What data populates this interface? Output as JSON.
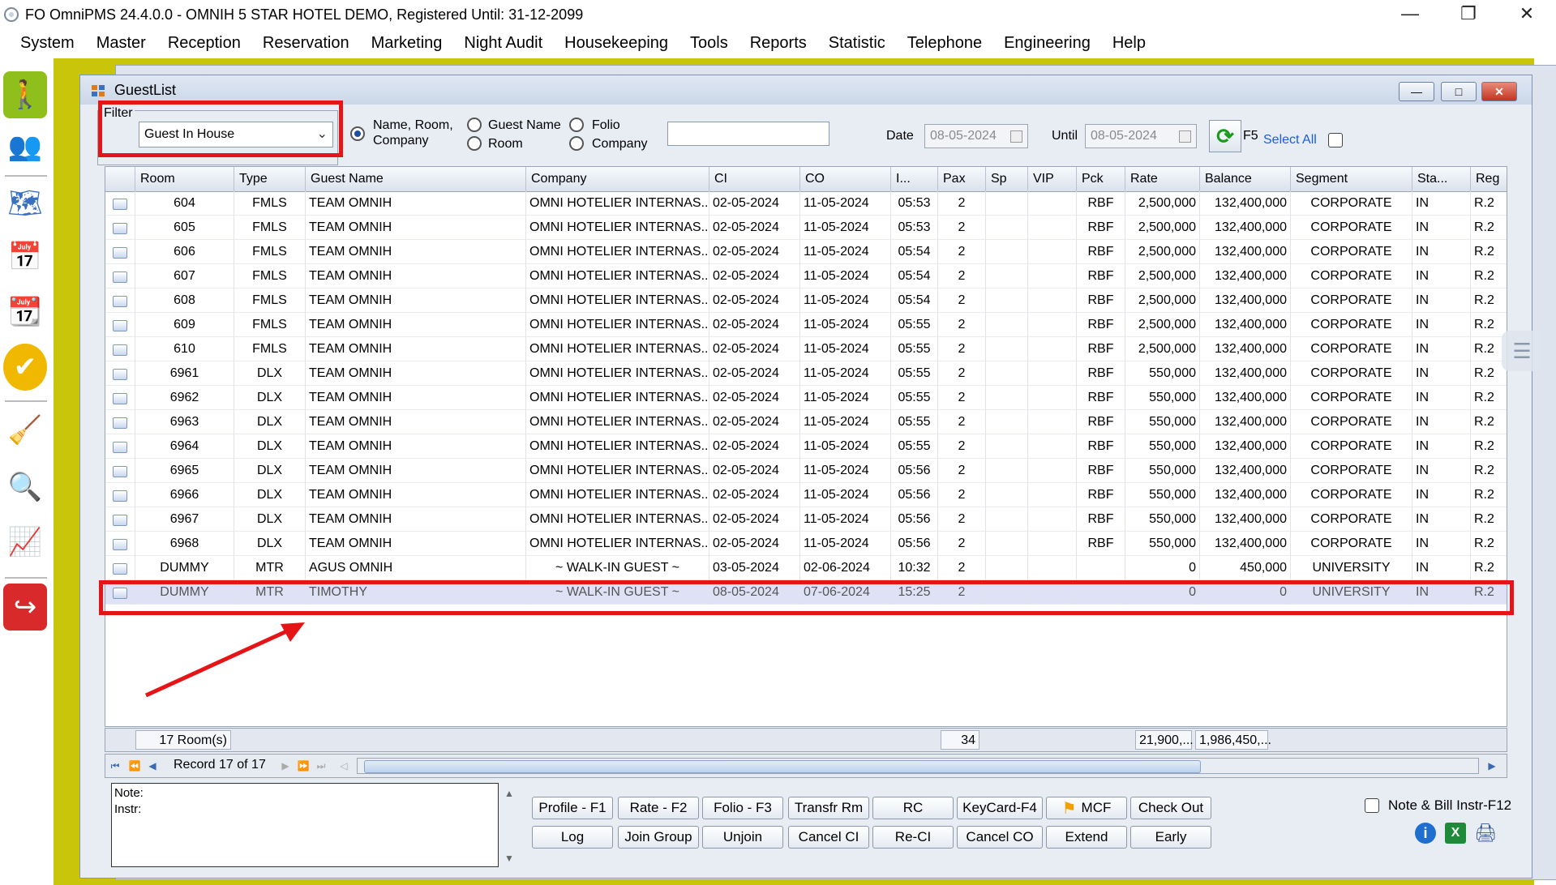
{
  "window": {
    "title": "FO OmniPMS 24.4.0.0 - OMNIH 5 STAR HOTEL DEMO, Registered Until: 31-12-2099"
  },
  "menu": [
    "System",
    "Master",
    "Reception",
    "Reservation",
    "Marketing",
    "Night Audit",
    "Housekeeping",
    "Tools",
    "Reports",
    "Statistic",
    "Telephone",
    "Engineering",
    "Help"
  ],
  "sidebar_icons": [
    "walk-in-icon",
    "guests-icon",
    "room-plan-icon",
    "calendar-icon",
    "calendar-2023-icon",
    "availability-icon",
    "housekeeping-icon",
    "analytics-icon",
    "report-chart-icon",
    "exit-icon"
  ],
  "guestlist": {
    "title": "GuestList",
    "filter_label": "Filter",
    "filter_value": "Guest In House",
    "radio_name_room_company": "Name, Room, Company",
    "radio_guest_name": "Guest Name",
    "radio_room": "Room",
    "radio_folio": "Folio",
    "radio_company": "Company",
    "date_label": "Date",
    "date_value": "08-05-2024",
    "until_label": "Until",
    "until_value": "08-05-2024",
    "f5_label": "F5",
    "select_all": "Select All"
  },
  "columns": [
    "Room",
    "Type",
    "Guest Name",
    "Company",
    "CI",
    "CO",
    "I...",
    "Pax",
    "Sp",
    "VIP",
    "Pck",
    "Rate",
    "Balance",
    "Segment",
    "Sta...",
    "Reg"
  ],
  "rows": [
    [
      "604",
      "FMLS",
      "TEAM OMNIH",
      "OMNI HOTELIER INTERNAS...",
      "02-05-2024",
      "11-05-2024",
      "05:53",
      "2",
      "",
      "",
      "RBF",
      "2,500,000",
      "132,400,000",
      "CORPORATE",
      "IN",
      "R.2"
    ],
    [
      "605",
      "FMLS",
      "TEAM OMNIH",
      "OMNI HOTELIER INTERNAS...",
      "02-05-2024",
      "11-05-2024",
      "05:53",
      "2",
      "",
      "",
      "RBF",
      "2,500,000",
      "132,400,000",
      "CORPORATE",
      "IN",
      "R.2"
    ],
    [
      "606",
      "FMLS",
      "TEAM OMNIH",
      "OMNI HOTELIER INTERNAS...",
      "02-05-2024",
      "11-05-2024",
      "05:54",
      "2",
      "",
      "",
      "RBF",
      "2,500,000",
      "132,400,000",
      "CORPORATE",
      "IN",
      "R.2"
    ],
    [
      "607",
      "FMLS",
      "TEAM OMNIH",
      "OMNI HOTELIER INTERNAS...",
      "02-05-2024",
      "11-05-2024",
      "05:54",
      "2",
      "",
      "",
      "RBF",
      "2,500,000",
      "132,400,000",
      "CORPORATE",
      "IN",
      "R.2"
    ],
    [
      "608",
      "FMLS",
      "TEAM OMNIH",
      "OMNI HOTELIER INTERNAS...",
      "02-05-2024",
      "11-05-2024",
      "05:54",
      "2",
      "",
      "",
      "RBF",
      "2,500,000",
      "132,400,000",
      "CORPORATE",
      "IN",
      "R.2"
    ],
    [
      "609",
      "FMLS",
      "TEAM OMNIH",
      "OMNI HOTELIER INTERNAS...",
      "02-05-2024",
      "11-05-2024",
      "05:55",
      "2",
      "",
      "",
      "RBF",
      "2,500,000",
      "132,400,000",
      "CORPORATE",
      "IN",
      "R.2"
    ],
    [
      "610",
      "FMLS",
      "TEAM OMNIH",
      "OMNI HOTELIER INTERNAS...",
      "02-05-2024",
      "11-05-2024",
      "05:55",
      "2",
      "",
      "",
      "RBF",
      "2,500,000",
      "132,400,000",
      "CORPORATE",
      "IN",
      "R.2"
    ],
    [
      "6961",
      "DLX",
      "TEAM OMNIH",
      "OMNI HOTELIER INTERNAS...",
      "02-05-2024",
      "11-05-2024",
      "05:55",
      "2",
      "",
      "",
      "RBF",
      "550,000",
      "132,400,000",
      "CORPORATE",
      "IN",
      "R.2"
    ],
    [
      "6962",
      "DLX",
      "TEAM OMNIH",
      "OMNI HOTELIER INTERNAS...",
      "02-05-2024",
      "11-05-2024",
      "05:55",
      "2",
      "",
      "",
      "RBF",
      "550,000",
      "132,400,000",
      "CORPORATE",
      "IN",
      "R.2"
    ],
    [
      "6963",
      "DLX",
      "TEAM OMNIH",
      "OMNI HOTELIER INTERNAS...",
      "02-05-2024",
      "11-05-2024",
      "05:55",
      "2",
      "",
      "",
      "RBF",
      "550,000",
      "132,400,000",
      "CORPORATE",
      "IN",
      "R.2"
    ],
    [
      "6964",
      "DLX",
      "TEAM OMNIH",
      "OMNI HOTELIER INTERNAS...",
      "02-05-2024",
      "11-05-2024",
      "05:55",
      "2",
      "",
      "",
      "RBF",
      "550,000",
      "132,400,000",
      "CORPORATE",
      "IN",
      "R.2"
    ],
    [
      "6965",
      "DLX",
      "TEAM OMNIH",
      "OMNI HOTELIER INTERNAS...",
      "02-05-2024",
      "11-05-2024",
      "05:56",
      "2",
      "",
      "",
      "RBF",
      "550,000",
      "132,400,000",
      "CORPORATE",
      "IN",
      "R.2"
    ],
    [
      "6966",
      "DLX",
      "TEAM OMNIH",
      "OMNI HOTELIER INTERNAS...",
      "02-05-2024",
      "11-05-2024",
      "05:56",
      "2",
      "",
      "",
      "RBF",
      "550,000",
      "132,400,000",
      "CORPORATE",
      "IN",
      "R.2"
    ],
    [
      "6967",
      "DLX",
      "TEAM OMNIH",
      "OMNI HOTELIER INTERNAS...",
      "02-05-2024",
      "11-05-2024",
      "05:56",
      "2",
      "",
      "",
      "RBF",
      "550,000",
      "132,400,000",
      "CORPORATE",
      "IN",
      "R.2"
    ],
    [
      "6968",
      "DLX",
      "TEAM OMNIH",
      "OMNI HOTELIER INTERNAS...",
      "02-05-2024",
      "11-05-2024",
      "05:56",
      "2",
      "",
      "",
      "RBF",
      "550,000",
      "132,400,000",
      "CORPORATE",
      "IN",
      "R.2"
    ],
    [
      "DUMMY",
      "MTR",
      "AGUS OMNIH",
      "~ WALK-IN GUEST ~",
      "03-05-2024",
      "02-06-2024",
      "10:32",
      "2",
      "",
      "",
      "",
      "0",
      "450,000",
      "UNIVERSITY",
      "IN",
      "R.2"
    ],
    [
      "DUMMY",
      "MTR",
      "TIMOTHY",
      "~ WALK-IN GUEST ~",
      "08-05-2024",
      "07-06-2024",
      "15:25",
      "2",
      "",
      "",
      "",
      "0",
      "0",
      "UNIVERSITY",
      "IN",
      "R.2"
    ]
  ],
  "footer": {
    "rooms": "17 Room(s)",
    "pax_total": "34",
    "rate_total": "21,900,...",
    "balance_total": "1,986,450,..."
  },
  "nav": {
    "record": "Record 17 of 17"
  },
  "notes": {
    "note_label": "Note:",
    "instr_label": "Instr:"
  },
  "buttons_row1": [
    "Profile - F1",
    "Rate - F2",
    "Folio - F3",
    "Transfr Rm",
    "RC",
    "KeyCard-F4",
    "MCF",
    "Check Out"
  ],
  "buttons_row2": [
    "Log",
    "Join Group",
    "Unjoin",
    "Cancel CI",
    "Re-CI",
    "Cancel CO",
    "Extend",
    "Early"
  ],
  "note_bill_label": "Note & Bill Instr-F12",
  "colors": {
    "highlight": "#e51416",
    "frame": "#c8c50b",
    "selected_row": "#dfe2f5"
  }
}
